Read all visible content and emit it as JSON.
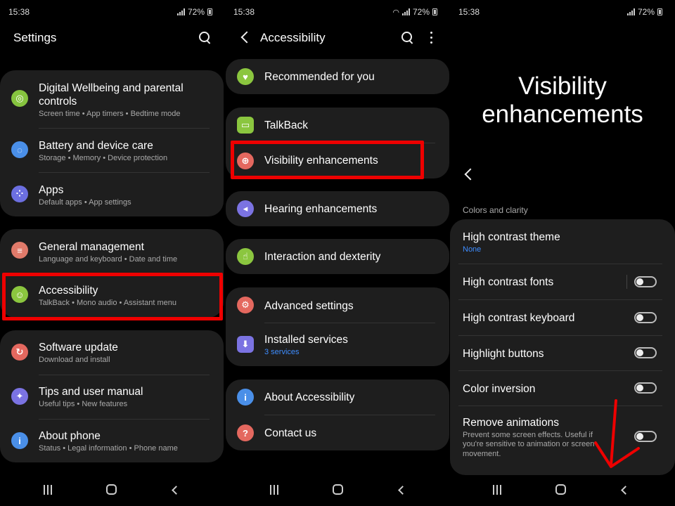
{
  "panel1": {
    "status": {
      "time": "15:38",
      "battery": "72%"
    },
    "title": "Settings",
    "groups": [
      [
        {
          "title": "Digital Wellbeing and parental controls",
          "title_l1": "Digital Wellbeing and parental",
          "title_l2": "controls",
          "subtitle": "Screen time  •  App timers  •  Bedtime mode",
          "icon": "digital-wellbeing-icon",
          "color": "#86c43f"
        },
        {
          "title": "Battery and device care",
          "subtitle": "Storage  •  Memory  •  Device protection",
          "icon": "device-care-icon",
          "color": "#4a8fe8"
        },
        {
          "title": "Apps",
          "subtitle": "Default apps  •  App settings",
          "icon": "apps-icon",
          "color": "#6c6fe0"
        }
      ],
      [
        {
          "title": "General management",
          "subtitle": "Language and keyboard  •  Date and time",
          "icon": "general-management-icon",
          "color": "#e07a6a"
        },
        {
          "title": "Accessibility",
          "subtitle": "TalkBack  •  Mono audio  •  Assistant menu",
          "icon": "accessibility-icon",
          "color": "#8bc63f"
        }
      ],
      [
        {
          "title": "Software update",
          "subtitle": "Download and install",
          "icon": "software-update-icon",
          "color": "#e4685f"
        },
        {
          "title": "Tips and user manual",
          "subtitle": "Useful tips  •  New features",
          "icon": "tips-icon",
          "color": "#7b73e2"
        },
        {
          "title": "About phone",
          "subtitle": "Status  •  Legal information  •  Phone name",
          "icon": "about-phone-icon",
          "color": "#4a8fe8"
        }
      ]
    ]
  },
  "panel2": {
    "status": {
      "time": "15:38",
      "battery": "72%"
    },
    "title": "Accessibility",
    "items": {
      "recommended": "Recommended for you",
      "talkback": "TalkBack",
      "visibility": "Visibility enhancements",
      "hearing": "Hearing enhancements",
      "interaction": "Interaction and dexterity",
      "advanced": "Advanced settings",
      "installed": "Installed services",
      "installed_sub": "3 services",
      "about": "About Accessibility",
      "contact": "Contact us"
    },
    "colors": {
      "green": "#8bc63f",
      "red": "#e4685f",
      "purple": "#7b73e2",
      "blue": "#4a8fe8"
    }
  },
  "panel3": {
    "status": {
      "time": "15:38",
      "battery": "72%"
    },
    "title_l1": "Visibility",
    "title_l2": "enhancements",
    "section": "Colors and clarity",
    "high_contrast_theme": "High contrast theme",
    "high_contrast_theme_value": "None",
    "high_contrast_fonts": "High contrast fonts",
    "high_contrast_keyboard": "High contrast keyboard",
    "highlight_buttons": "Highlight buttons",
    "color_inversion": "Color inversion",
    "remove_animations": "Remove animations",
    "remove_animations_sub_l1": "Prevent some screen effects. Useful if",
    "remove_animations_sub_l2": "you're sensitive to animation or screen",
    "remove_animations_sub_l3": "movement."
  },
  "accent": "#e00000"
}
